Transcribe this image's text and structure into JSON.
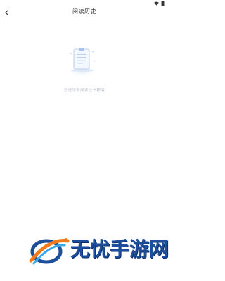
{
  "status_bar": {
    "icons": [
      "wifi-icon",
      "battery-icon"
    ]
  },
  "app_bar": {
    "back_icon": "chevron-left-icon",
    "title": "阅读历史"
  },
  "empty_state": {
    "icon": "clipboard-document-icon",
    "message": "您还没有阅读过书籍哦"
  },
  "watermark": {
    "text": "无忧手游网",
    "colors": {
      "blue": "#1d4e9b",
      "orange": "#f07a1a",
      "light_blue": "#3aa7e8"
    }
  },
  "colors": {
    "background": "#ffffff",
    "title": "#222222",
    "empty_text": "#b9bfc9",
    "illustration_blue": "#8fb4ea"
  }
}
